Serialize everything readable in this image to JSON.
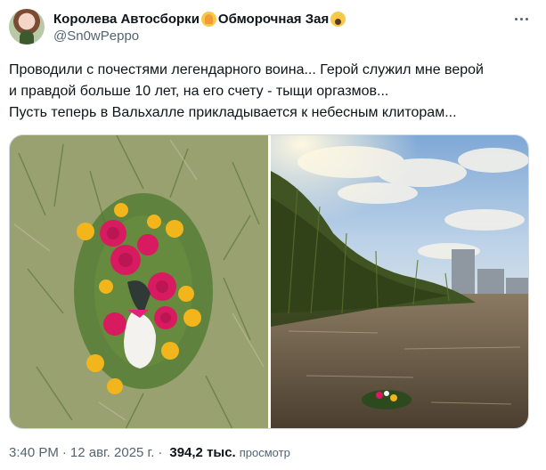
{
  "author": {
    "display_name": "Королева Автосборки",
    "display_name_suffix": "Обморочная Зая",
    "handle": "@Sn0wPeppo",
    "avatar_icon": "avatar-photo",
    "emoji_1": "folded-hands-emoji",
    "emoji_2": "screaming-face-emoji"
  },
  "tweet": {
    "lines": [
      "Проводили с почестями легендарного воина... Герой служил мне верой",
      "и правдой больше 10 лет, на его счету - тыщи оргазмов...",
      "Пусть теперь в Вальхалле прикладывается к небесным клиторам..."
    ]
  },
  "media": {
    "left_image": "flower-wreath-on-grass-photo",
    "right_image": "wreath-floating-on-river-photo"
  },
  "meta": {
    "time": "3:40 PM",
    "separator": "·",
    "date": "12 авг. 2025 г.",
    "views_count": "394,2 тыс.",
    "views_label": "просмотр"
  },
  "colors": {
    "text": "#0f1419",
    "secondary": "#536471",
    "border": "#cfd9de"
  }
}
